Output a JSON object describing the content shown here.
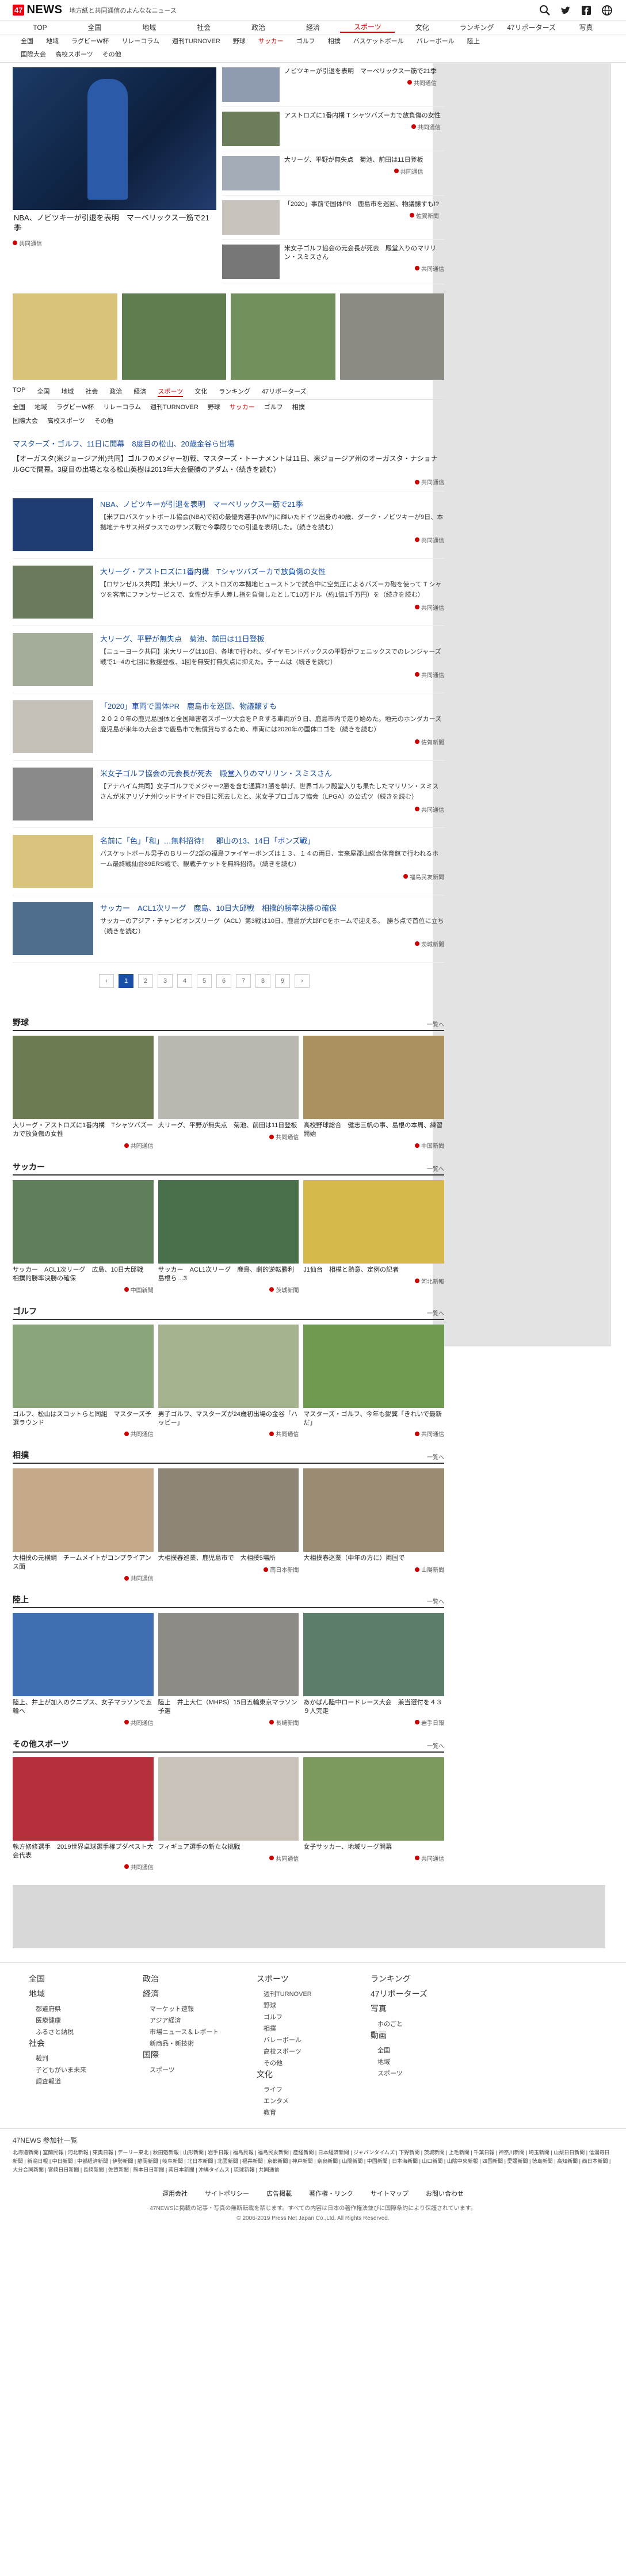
{
  "header": {
    "logo_badge": "47",
    "logo_text": "NEWS",
    "tagline": "地方紙と共同通信のよんななニュース"
  },
  "nav": {
    "primary": [
      "TOP",
      "全国",
      "地域",
      "社会",
      "政治",
      "経済",
      "スポーツ",
      "文化",
      "ランキング",
      "47リポーターズ",
      "写真"
    ],
    "secondary": [
      "全国",
      "地域",
      "ラグビーW杯",
      "リレーコラム",
      "週刊TURNOVER",
      "野球",
      "サッカー",
      "ゴルフ",
      "相撲",
      "バスケットボール",
      "バレーボール",
      "陸上"
    ],
    "tertiary": [
      "国際大会",
      "高校スポーツ",
      "その他"
    ]
  },
  "hero": {
    "main_caption": "NBA、ノビツキーが引退を表明　マーベリックス一筋で21季",
    "main_source": "共同通信",
    "list": [
      {
        "text": "ノビツキーが引退を表明　マーベリックス一筋で21季",
        "source": "共同通信"
      },
      {
        "text": "アストロズに1番内構 T シャツバズーカで放負傷の女性",
        "source": "共同通信"
      },
      {
        "text": "大リーグ、平野が無失点　菊池、前田は11日登板",
        "source": "共同通信"
      },
      {
        "text": "「2020」事前で国体PR　鹿島市を巡回、物議醸すも!?",
        "source": "佐賀新聞"
      },
      {
        "text": "米女子ゴルフ協会の元会長が死去　殿堂入りのマリリン・スミスさん",
        "source": "共同通信"
      }
    ]
  },
  "subnav_small": {
    "row1": [
      "TOP",
      "全国",
      "地域",
      "社会",
      "政治",
      "経済",
      "スポーツ",
      "文化",
      "ランキング",
      "47リポーターズ",
      "写真"
    ],
    "row2": [
      "全国",
      "地域",
      "ラグビーW杯",
      "リレーコラム",
      "週刊TURNOVER",
      "野球",
      "サッカー",
      "ゴルフ",
      "相撲",
      "バスケットボール"
    ],
    "row3": [
      "国際大会",
      "高校スポーツ",
      "その他"
    ]
  },
  "lead": {
    "title": "マスターズ・ゴルフ、11日に開幕　8度目の松山、20歳金谷ら出場",
    "body": "【オーガスタ(米ジョージア州)共同】ゴルフのメジャー初戦、マスターズ・トーナメントは11日、米ジョージア州のオーガスタ・ナショナルGCで開幕。3度目の出場となる松山英樹は2013年大会優勝のアダム・（続きを読む）",
    "source": "共同通信"
  },
  "articles": [
    {
      "title": "NBA、ノビツキーが引退を表明　マーベリックス一筋で21季",
      "text": "【米プロバスケットボール協会(NBA)で初の最優秀選手(MVP)に輝いたドイツ出身の40歳、ダーク・ノビツキーが9日、本拠地テキサス州ダラスでのサンズ戦で今季限りでの引退を表明した。（続きを読む）",
      "source": "共同通信"
    },
    {
      "title": "大リーグ・アストロズに1番内構　Tシャツバズーカで放負傷の女性",
      "text": "【ロサンゼルス共同】米大リーグ、アストロズの本拠地ヒューストンで試合中に空気圧によるバズーカ砲を使って T シャツを客席にファンサービスで、女性が左手人差し指を負傷したとして10万ドル（約1億1千万円）を（続きを読む）",
      "source": "共同通信"
    },
    {
      "title": "大リーグ、平野が無失点　菊池、前田は11日登板",
      "text": "【ニューヨーク共同】米大リーグは10日、各地で行われ、ダイヤモンドバックスの平野がフェニックスでのレンジャーズ戦で1─4の七回に救援登板、1回を無安打無失点に抑えた。チームは（続きを読む）",
      "source": "共同通信"
    },
    {
      "title": "「2020」車両で国体PR　鹿島市を巡回、物議醸すも",
      "text": "２０２０年の鹿児島国体と全国障害者スポーツ大会をＰＲする車両が９日、鹿島市内で走り始めた。地元のホンダカーズ鹿児島が来年の大会まで鹿島市で無償貸与するため、車両には2020年の国体ロゴを（続きを読む）",
      "source": "佐賀新聞"
    },
    {
      "title": "米女子ゴルフ協会の元会長が死去　殿堂入りのマリリン・スミスさん",
      "text": "【アナハイム共同】女子ゴルフでメジャー2勝を含む通算21勝を挙げ、世界ゴルフ殿堂入りも果たしたマリリン・スミスさんが米アリゾナ州ウッドサイドで9日に死去したと、米女子プロゴルフ協会（LPGA）の公式ツ（続きを読む）",
      "source": "共同通信"
    },
    {
      "title": "名前に「色」「和」…無料招待！　郡山の13、14日「ボンズ戦」",
      "text": "バスケットボール男子のＢリーグ2部の福島ファイヤーボンズは１３、１４の両日、宝来屋郡山総合体育館で行われるホーム最終戦仙台89ERS戦で、観戦チケットを無料招待。（続きを読む）",
      "source": "福島民友新聞"
    },
    {
      "title": "サッカー　ACL1次リーグ　鹿島、10日大邱戦　相撲的勝率決勝の確保",
      "text": "サッカーのアジア・チャンピオンズリーグ（ACL）第3戦は10日、鹿島が大邱FCをホームで迎える。　勝ち点で首位に立ち（続きを読む）",
      "source": "茨城新聞"
    }
  ],
  "pager": [
    "‹",
    "1",
    "2",
    "3",
    "4",
    "5",
    "6",
    "7",
    "8",
    "9",
    "›"
  ],
  "sections": [
    {
      "title": "野球",
      "more": "一覧へ",
      "cards": [
        {
          "caption": "大リーグ・アストロズに1番内構　Tシャツバズーカで放負傷の女性",
          "source": "共同通信"
        },
        {
          "caption": "大リーグ、平野が無失点　菊池、前田は11日登板",
          "source": "共同通信"
        },
        {
          "caption": "高校野球総合　健志三帆の事、島根の本周、練習開始",
          "source": "中国新聞"
        }
      ]
    },
    {
      "title": "サッカー",
      "more": "一覧へ",
      "cards": [
        {
          "caption": "サッカー　ACL1次リーグ　広島、10日大邱戦　相撲的勝率決勝の確保",
          "source": "中国新聞"
        },
        {
          "caption": "サッカー　ACL1次リーグ　鹿島、劇的逆転勝利　島根ら…3",
          "source": "茨城新聞"
        },
        {
          "caption": "J1仙台　相模と熱意、定例の記者",
          "source": "河北新報"
        }
      ]
    },
    {
      "title": "ゴルフ",
      "more": "一覧へ",
      "cards": [
        {
          "caption": "ゴルフ、松山はスコットらと同組　マスターズ予選ラウンド",
          "source": "共同通信"
        },
        {
          "caption": "男子ゴルフ、マスターズが24歳初出場の金谷「ハッピー」",
          "source": "共同通信"
        },
        {
          "caption": "マスターズ・ゴルフ、今年も鋭翼「きれいで最新だ」",
          "source": "共同通信"
        }
      ]
    },
    {
      "title": "相撲",
      "more": "一覧へ",
      "cards": [
        {
          "caption": "大相撲の元横綱　チームメイトがコンプライアンス面",
          "source": "共同通信"
        },
        {
          "caption": "大相撲春巡業、鹿児島市で　大相撲5場所",
          "source": "南日本新聞"
        },
        {
          "caption": "大相撲春巡業（中年の方に）両国で",
          "source": "山陽新聞"
        }
      ]
    },
    {
      "title": "陸上",
      "more": "一覧へ",
      "cards": [
        {
          "caption": "陸上、井上が加入のクニプス、女子マラソンで五輪へ",
          "source": "共同通信"
        },
        {
          "caption": "陸上　井上大仁（MHPS）15日五輪東京マラソン予選",
          "source": "長崎新聞"
        },
        {
          "caption": "あかばん陸中ロードレース大会　兼当選付を４３９人完走",
          "source": "岩手日報"
        }
      ]
    },
    {
      "title": "その他スポーツ",
      "more": "一覧へ",
      "cards": [
        {
          "caption": "執方修修選手　2019世界卓球選手権プダペスト大会代表",
          "source": "共同通信"
        },
        {
          "caption": "フィギュア選手の新たな挑戦",
          "source": "共同通信"
        },
        {
          "caption": "女子サッカー、地域リーグ開幕",
          "source": "共同通信"
        }
      ]
    }
  ],
  "footer": {
    "columns": [
      {
        "head": "全国",
        "items": []
      },
      {
        "head": "地域",
        "items": [
          "都道府県",
          "医療健康",
          "ふるさと納税"
        ]
      },
      {
        "head": "社会",
        "items": [
          "裁判",
          "子どもがいま未来",
          "調査報道"
        ]
      },
      {
        "head": "政治",
        "items": []
      },
      {
        "head": "経済",
        "items": [
          "マーケット速報",
          "アジア経済",
          "市場ニュース＆レポート",
          "新商品・新技術"
        ]
      },
      {
        "head": "国際",
        "items": [
          "スポーツ"
        ]
      },
      {
        "head": "スポーツ",
        "items": [
          "週刊TURNOVER",
          "野球",
          "ゴルフ",
          "相撲",
          "バレーボール",
          "高校スポーツ",
          "その他"
        ]
      },
      {
        "head": "文化",
        "items": [
          "ライフ",
          "エンタメ",
          "教育"
        ]
      },
      {
        "head": "ランキング",
        "items": []
      },
      {
        "head": "47リポーターズ",
        "items": []
      },
      {
        "head": "写真",
        "items": [
          "ホのごと"
        ]
      },
      {
        "head": "動画",
        "items": [
          "全国",
          "地域",
          "スポーツ"
        ]
      }
    ],
    "partners_title": "47NEWS 参加社一覧",
    "partners": "北海道新聞 | 室蘭民報 | 河北新報 | 東奥日報 | デーリー東北 | 秋田魁新報 | 山形新聞 | 岩手日報 | 福島民報 | 福島民友新聞 | 産経新聞 | 日本経済新聞 | ジャパンタイムズ | 下野新聞 | 茨城新聞 | 上毛新聞 | 千葉日報 | 神奈川新聞 | 埼玉新聞 | 山梨日日新聞 | 信濃毎日新聞 | 新潟日報 | 中日新聞 | 中部経済新聞 | 伊勢新聞 | 静岡新聞 | 岐阜新聞 | 北日本新聞 | 北國新聞 | 福井新聞 | 京都新聞 | 神戸新聞 | 奈良新聞 | 山陽新聞 | 中国新聞 | 日本海新聞 | 山口新聞 | 山陰中央新報 | 四国新聞 | 愛媛新聞 | 徳島新聞 | 高知新聞 | 西日本新聞 | 大分合同新聞 | 宮崎日日新聞 | 長崎新聞 | 佐賀新聞 | 熊本日日新聞 | 南日本新聞 | 沖縄タイムス | 琉球新報 | 共同通信",
    "links": [
      "運用会社",
      "サイトポリシー",
      "広告掲載",
      "著作権・リンク",
      "サイトマップ",
      "お問い合わせ"
    ],
    "notice": "47NEWSに掲載の記事・写真の無断転載を禁じます。すべての内容は日本の著作権法並びに国際条約により保護されています。",
    "copyright": "© 2006-2019 Press Net Japan Co.,Ltd. All Rights Reserved."
  }
}
